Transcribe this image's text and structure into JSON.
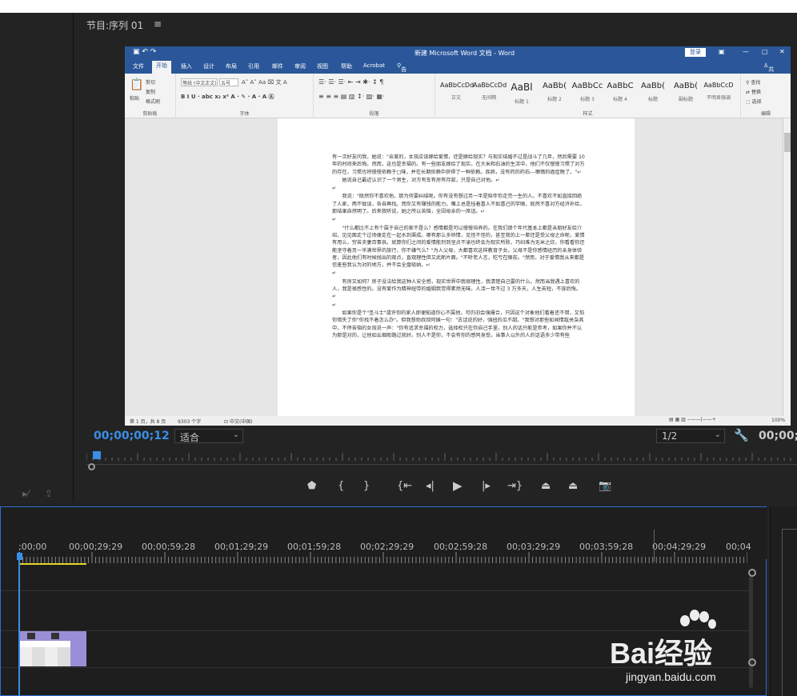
{
  "program": {
    "title": "节目:序列 01",
    "menu_icon": "hamburger-icon",
    "timecode": "00;00;00;12",
    "fit": "适合",
    "resolution": "1/2",
    "timecode_right": "00;00;2"
  },
  "word": {
    "title": "新建 Microsoft Word 文档 - Word",
    "login": "登录",
    "tabs": [
      "文件",
      "开始",
      "插入",
      "设计",
      "布局",
      "引用",
      "邮件",
      "审阅",
      "视图",
      "帮助",
      "Acrobat",
      "告诉我你想要做什么"
    ],
    "share": "共享",
    "ribbon": {
      "clipboard": [
        "粘贴",
        "剪切",
        "复制",
        "格式刷"
      ],
      "clipboard_label": "剪贴板",
      "font_name": "等线 (中文正文)",
      "font_size": "五号",
      "font_label": "字体",
      "paragraph_label": "段落",
      "styles": [
        {
          "sample": "AaBbCcDd",
          "name": "正文"
        },
        {
          "sample": "AaBbCcDd",
          "name": "无间隔"
        },
        {
          "sample": "AaBl",
          "name": "标题 1"
        },
        {
          "sample": "AaBb(",
          "name": "标题 2"
        },
        {
          "sample": "AaBbCc",
          "name": "标题 3"
        },
        {
          "sample": "AaBbC",
          "name": "标题 4"
        },
        {
          "sample": "AaBb(",
          "name": "标题"
        },
        {
          "sample": "AaBb(",
          "name": "副标题"
        },
        {
          "sample": "AaBbCcD",
          "name": "不明显强调"
        }
      ],
      "styles_label": "样式",
      "editing": [
        "查找",
        "替换",
        "选择"
      ],
      "editing_label": "编辑"
    },
    "doc": [
      "有一次好友问我，她说：\"亲爱的，女孩应该嫁给爱情，还是嫁给现实？与现实结婚不过是战斗了几年，然后需要 10 年的时间来后悔。然而，这也是幸福的。有一些朋友嫁给了现实。在大米和石油的生活中，他们不仅慢慢习惯了对方的存在，习惯也将慢慢依赖于□味，并在长期依赖中获得了一种依赖。疾病，没有药的药石---懒惰的癌症晚了。\"↵",
      "她说自己最近认识了一个男生，对方有车有房有存款，只是自己对他。↵",
      "↵",
      "我说：\"既然你不喜欢他，那为何要纠结呢。你有没有想过另一半是陪伴你走完一生的人。不喜欢不如直接回绝了人家，两不耽误，各自再找。而你又有赚钱的能力，嘴上总是挂着喜人不如喜己的字眼，既然不喜对方经济补给，那结果自然明了。后来我听说，她之所以苦恼，全因母亲的一席话。↵",
      "↵",
      "\"什么都比不上有个属于自己的家不是么？感情都是可以慢慢培养的。在我们那个年代基本上都是亲朋好友给介绍，见见面走个过场便走在一起水到渠成。哪有那么多矫情，见怪不怪的，甚至我的上一辈还是受父母之命呢，爱情有用么，穷苦夫妻百事哀。就算你们之间的爱情能烈到坚贞不渝也终会为现实所败，巧妇难为无米之炊，你看看你还能坚守着另一半满世界的旅行，你不嫌气么？\"为人父母，大都喜欢这样教育子女。父母不是你感情经历的亲身体验者，因此他们有时候抛出的观点，直观理性但又武断片面。\"不听老人言，吃亏在眼前。\"然而，对于爱情我从来都是信鉴些我认为对的地方，并不会全盘吸纳。↵",
      "↵",
      "有房又如何？房子没法给我这种人安全感，现实世界中我很理性，我清楚自己要的什么。然而当我遇上喜欢的人，我是很感性的。没有爱作为精神纽带的婚姻我觉得素然无味。人活一世不过 3 万多天，人生苦短，不容后悔。↵",
      "↵",
      "如果你是个\"圣斗士\"或许你的家人即便知道你心不属他，可仍旧会强撮合，只因这个对象他们看着还不错，又怕你错失了你\"你找不着怎么办\"。但我想劝叔叔阿姨一句：\"古话说的好，强扭的瓜不甜。\"我想对那些如闻情敌关杂其中，不停苦恼的女孩说一声：\"你有追求幸福的权力，选择权只在你自己手里，别人的话只能是参考，如果你并不认为那是对的，让他如云烟般路过就好。别人不是你，不会有你的感同身受。当事人以外的人的话语多少带有些"
    ],
    "status": {
      "page": "第 1 页，共 8 页",
      "words": "9303 个字",
      "lang": "中文(中国)",
      "zoom": "100%"
    }
  },
  "timeline": {
    "labels": [
      ";00;00",
      "00;00;29;29",
      "00;00;59;28",
      "00;01;29;29",
      "00;01;59;28",
      "00;02;29;29",
      "00;02;59;28",
      "00;03;29;29",
      "00;03;59;28",
      "00;04;29;29",
      "00;04"
    ]
  },
  "watermark": {
    "brand": "Bai经验",
    "url": "jingyan.baidu.com"
  }
}
